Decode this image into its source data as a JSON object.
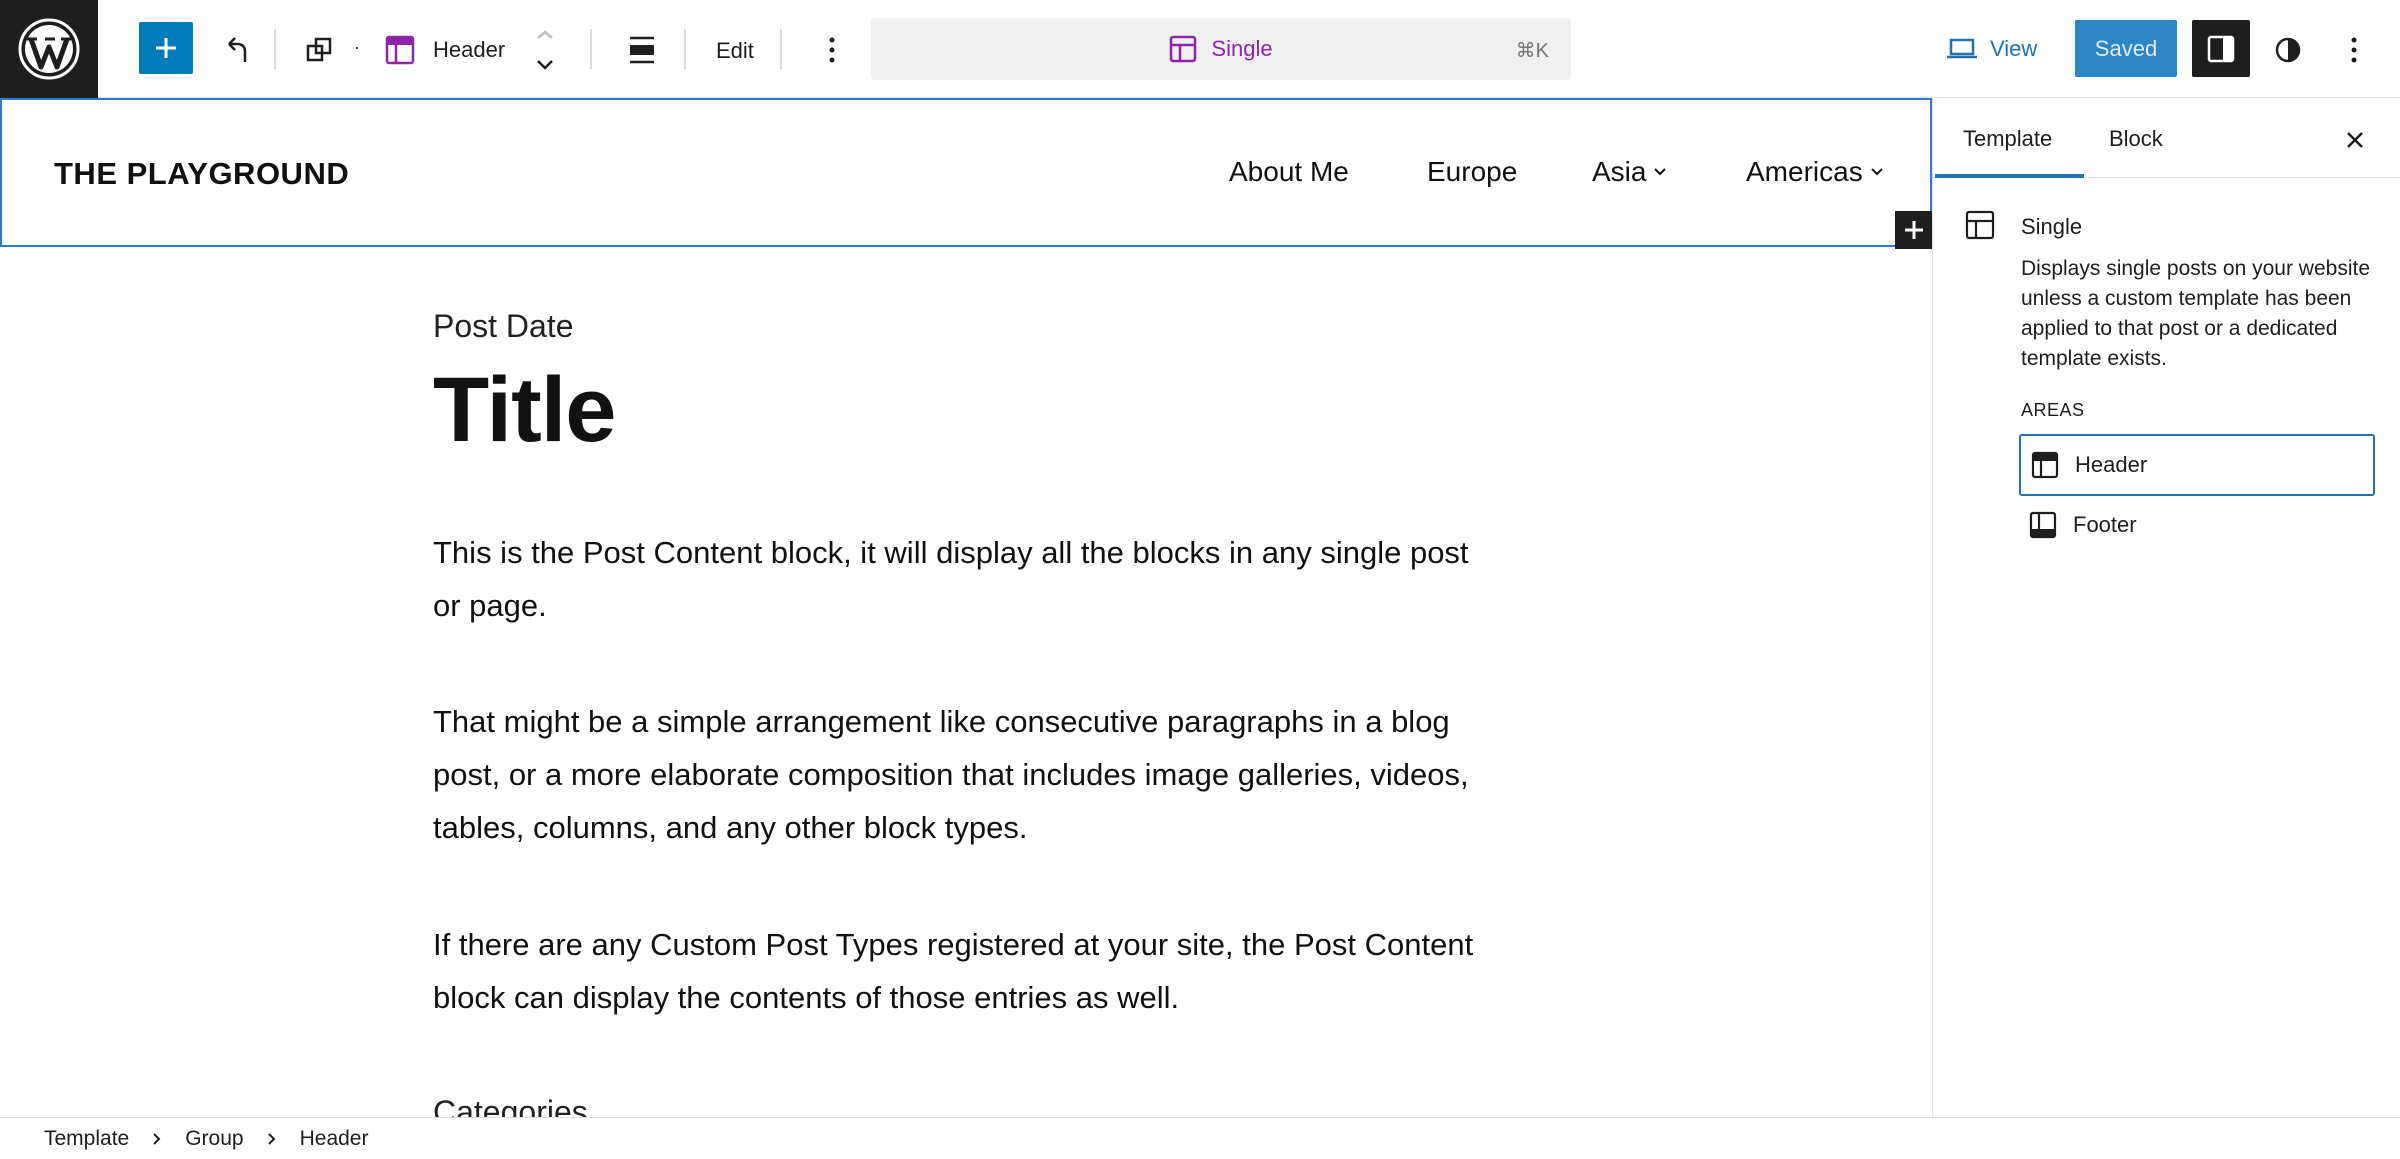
{
  "toolbar": {
    "block_name": "Header",
    "edit_label": "Edit",
    "command": {
      "title": "Single",
      "shortcut": "⌘K"
    },
    "view_label": "View",
    "saved_label": "Saved"
  },
  "canvas": {
    "site_title": "THE PLAYGROUND",
    "nav": [
      "About Me",
      "Europe",
      "Asia",
      "Americas"
    ],
    "post_date": "Post Date",
    "post_title": "Title",
    "paragraphs": [
      "This is the Post Content block, it will display all the blocks in any single post or page.",
      "That might be a simple arrangement like consecutive paragraphs in a blog post, or a more elaborate composition that includes image galleries, videos, tables, columns, and any other block types.",
      "If there are any Custom Post Types registered at your site, the Post Content block can display the contents of those entries as well."
    ],
    "categories": "Categories"
  },
  "sidebar": {
    "tabs": [
      "Template",
      "Block"
    ],
    "template_name": "Single",
    "template_desc": "Displays single posts on your website unless a custom template has been applied to that post or a dedicated template exists.",
    "areas_label": "AREAS",
    "areas": [
      "Header",
      "Footer"
    ]
  },
  "breadcrumb": [
    "Template",
    "Group",
    "Header"
  ],
  "colors": {
    "accent": "#007cba",
    "selection": "#2e7bd0",
    "template_purple": "#8e24aa"
  }
}
